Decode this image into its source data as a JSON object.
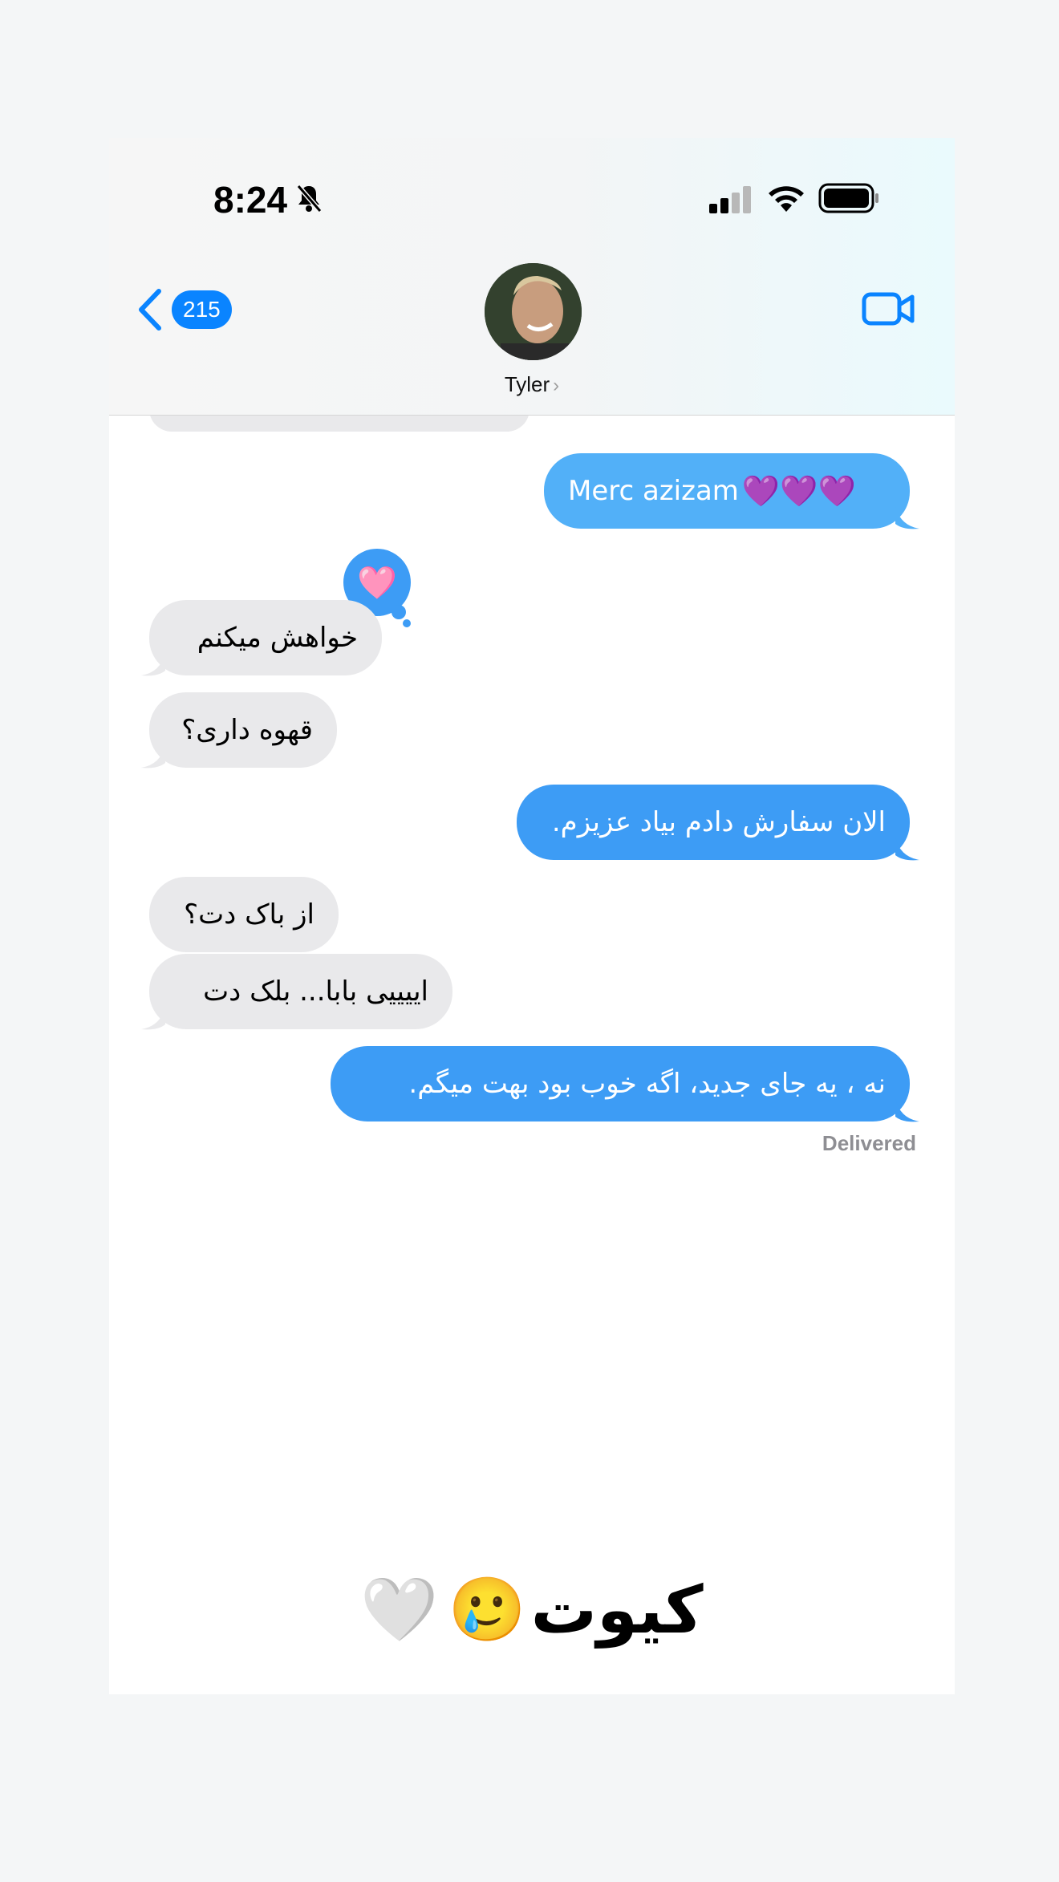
{
  "status_bar": {
    "time": "8:24"
  },
  "nav": {
    "unread_count": "215",
    "contact_name": "Tyler",
    "name_chevron": "›"
  },
  "messages": [
    {
      "direction": "out",
      "text": "Merc azizam ",
      "emoji": "💜💜💜"
    },
    {
      "direction": "in",
      "text": "خواهش میکنم",
      "tapback": "🩷"
    },
    {
      "direction": "in",
      "text": "قهوه داری؟"
    },
    {
      "direction": "out",
      "text": "الان سفارش دادم بیاد عزیزم."
    },
    {
      "direction": "in",
      "text": "از باک دت؟"
    },
    {
      "direction": "in",
      "text": "اییییی بابا... بلک دت"
    },
    {
      "direction": "out",
      "text": "نه ، یه جای جدید، اگه خوب بود بهت میگم."
    }
  ],
  "delivered_label": "Delivered",
  "caption": {
    "text": "کیوت",
    "emojis": [
      "🥲",
      "🤍"
    ]
  },
  "colors": {
    "accent": "#0a84ff",
    "bubble_out": "#3d9cf5",
    "bubble_in": "#e9e9eb"
  }
}
